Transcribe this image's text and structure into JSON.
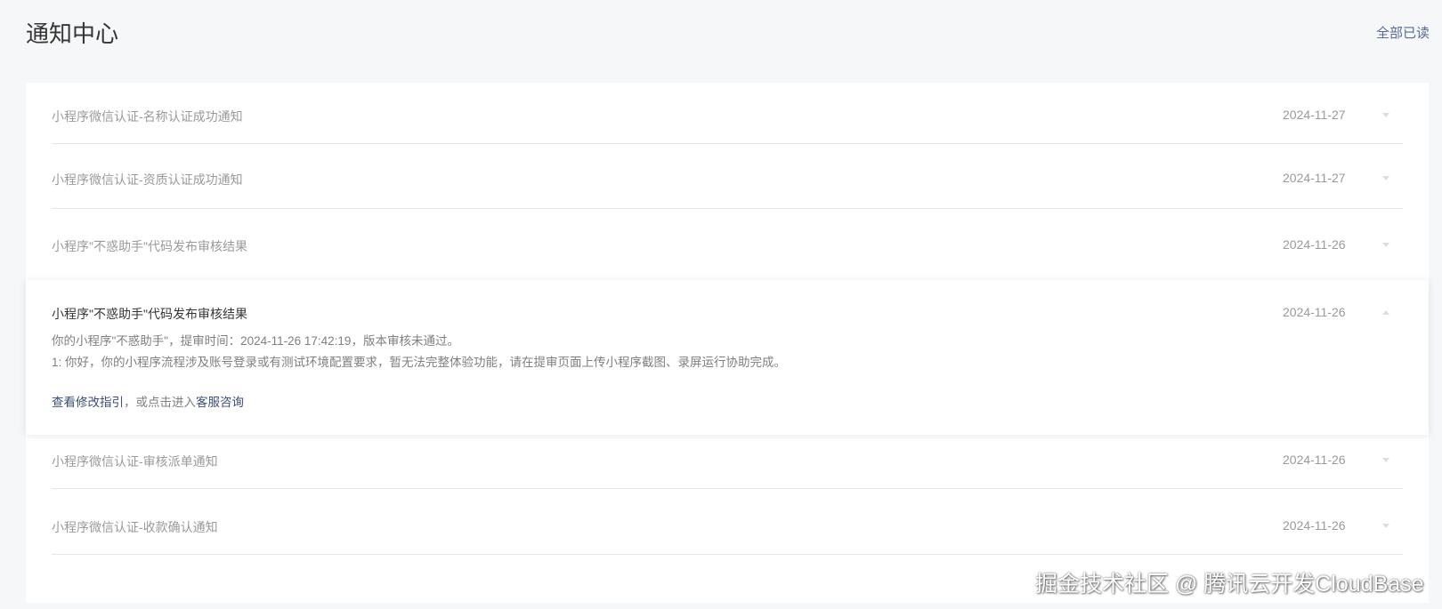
{
  "header": {
    "title": "通知中心",
    "mark_all_read": "全部已读"
  },
  "notifications": [
    {
      "title": "小程序微信认证-名称认证成功通知",
      "date": "2024-11-27",
      "expanded": false
    },
    {
      "title": "小程序微信认证-资质认证成功通知",
      "date": "2024-11-27",
      "expanded": false
    },
    {
      "title": "小程序\"不惑助手\"代码发布审核结果",
      "date": "2024-11-26",
      "expanded": false
    },
    {
      "title": "小程序\"不惑助手\"代码发布审核结果",
      "date": "2024-11-26",
      "expanded": true,
      "body_line1": "你的小程序\"不惑助手\"，提审时间：2024-11-26 17:42:19，版本审核未通过。",
      "body_line2": "1: 你好，你的小程序流程涉及账号登录或有测试环境配置要求，暂无法完整体验功能，请在提审页面上传小程序截图、录屏运行协助完成。",
      "guide_link": "查看修改指引",
      "guide_middle": "，或点击进入",
      "support_link": "客服咨询"
    },
    {
      "title": "小程序微信认证-审核派单通知",
      "date": "2024-11-26",
      "expanded": false
    },
    {
      "title": "小程序微信认证-收款确认通知",
      "date": "2024-11-26",
      "expanded": false
    }
  ],
  "watermark": "掘金技术社区 @ 腾讯云开发CloudBase"
}
